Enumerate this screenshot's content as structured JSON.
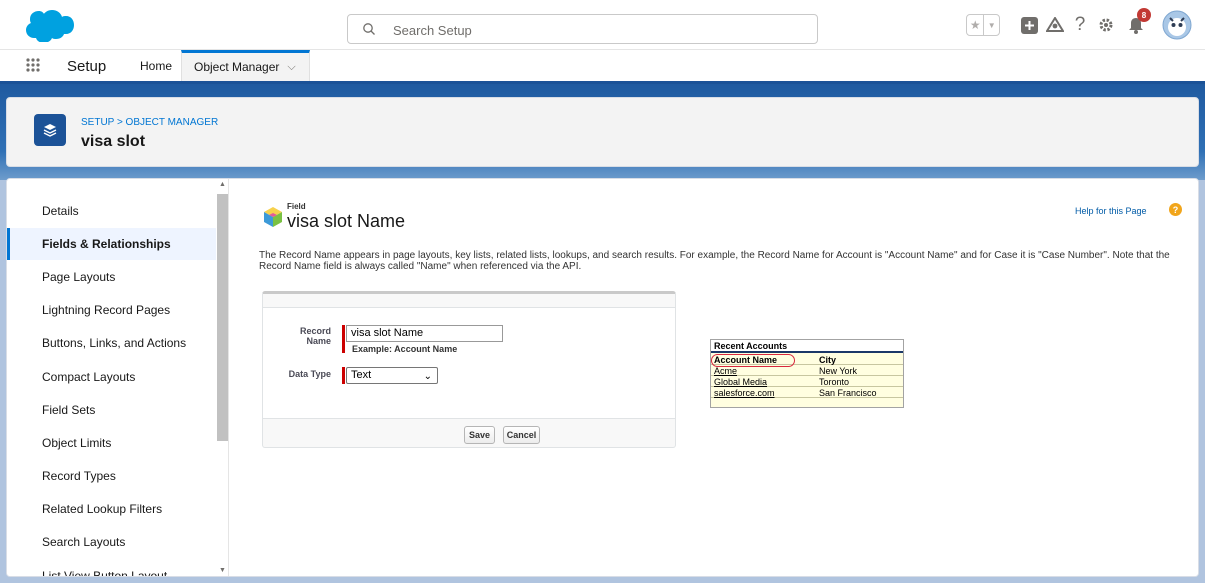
{
  "header": {
    "search_placeholder": "Search Setup",
    "notification_count": "8"
  },
  "nav": {
    "app_title": "Setup",
    "tabs": [
      {
        "label": "Home"
      },
      {
        "label": "Object Manager"
      }
    ]
  },
  "page_header": {
    "breadcrumb": "SETUP > OBJECT MANAGER",
    "object_title": "visa slot"
  },
  "sidebar": {
    "items": [
      {
        "label": "Details"
      },
      {
        "label": "Fields & Relationships",
        "active": true
      },
      {
        "label": "Page Layouts"
      },
      {
        "label": "Lightning Record Pages"
      },
      {
        "label": "Buttons, Links, and Actions"
      },
      {
        "label": "Compact Layouts"
      },
      {
        "label": "Field Sets"
      },
      {
        "label": "Object Limits"
      },
      {
        "label": "Record Types"
      },
      {
        "label": "Related Lookup Filters"
      },
      {
        "label": "Search Layouts"
      },
      {
        "label": "List View Button Layout"
      }
    ]
  },
  "field": {
    "label": "Field",
    "title": "visa slot Name",
    "help_link": "Help for this Page",
    "help_icon": "?",
    "description": "The Record Name appears in page layouts, key lists, related lists, lookups, and search results. For example, the Record Name for Account is \"Account Name\" and for Case it is \"Case Number\". Note that the Record Name field is always called \"Name\" when referenced via the API."
  },
  "form": {
    "record_name_label_line1": "Record",
    "record_name_label_line2": "Name",
    "record_name_value": "visa slot Name",
    "example_text": "Example:  Account Name",
    "data_type_label": "Data Type",
    "data_type_value": "Text",
    "save_label": "Save",
    "cancel_label": "Cancel"
  },
  "recent_accounts": {
    "title": "Recent Accounts",
    "columns": [
      "Account Name",
      "City"
    ],
    "rows": [
      [
        "Acme",
        "New York"
      ],
      [
        "Global Media",
        "Toronto"
      ],
      [
        "salesforce.com",
        "San Francisco"
      ]
    ]
  },
  "colors": {
    "brand_blue": "#0176d3",
    "nav_dark": "#1b5297",
    "required": "#cc0000"
  }
}
